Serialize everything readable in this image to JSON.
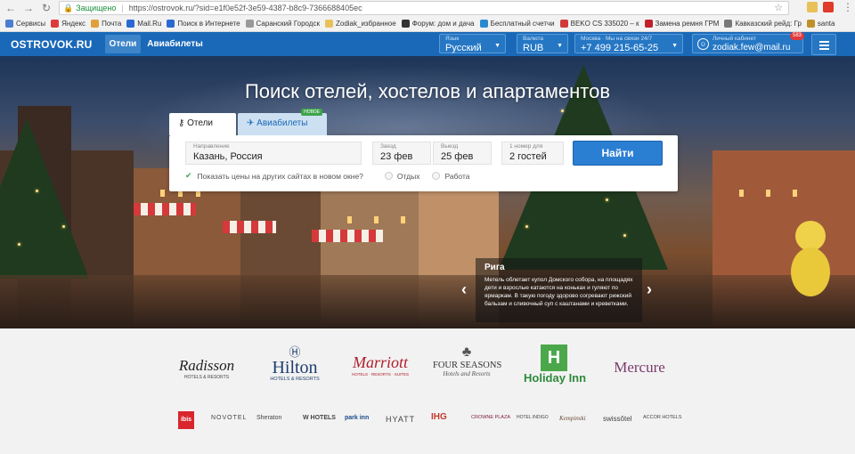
{
  "browser": {
    "secure_label": "Защищено",
    "url": "https://ostrovok.ru/?sid=e1f0e52f-3e59-4387-b8c9-7366688405ec",
    "bookmarks": [
      {
        "label": "Сервисы",
        "icon": "apps-icon",
        "color": "#4a7fd0"
      },
      {
        "label": "Яндекс",
        "icon": "yandex-icon",
        "color": "#e0393a"
      },
      {
        "label": "Почта",
        "icon": "mail-icon",
        "color": "#e0a03a"
      },
      {
        "label": "Mail.Ru",
        "icon": "mailru-icon",
        "color": "#2a6ad0"
      },
      {
        "label": "Поиск в Интернете",
        "icon": "search-icon",
        "color": "#2a6ad0"
      },
      {
        "label": "Саранский Городск",
        "icon": "page-icon",
        "color": "#999999"
      },
      {
        "label": "Zodiak_избранное",
        "icon": "folder-icon",
        "color": "#e8c15a"
      },
      {
        "label": "Форум: дом и дача",
        "icon": "forum-icon",
        "color": "#333333"
      },
      {
        "label": "Бесплатный счетчи",
        "icon": "counter-icon",
        "color": "#2a8ad0"
      },
      {
        "label": "BEKO CS 335020 – к",
        "icon": "beko-icon",
        "color": "#d03a3a"
      },
      {
        "label": "Замена ремня ГРМ",
        "icon": "d-icon",
        "color": "#c0202a"
      },
      {
        "label": "Кавказский рейд: Гр",
        "icon": "settings-icon",
        "color": "#777777"
      },
      {
        "label": "santa",
        "icon": "santa-icon",
        "color": "#c0902a"
      }
    ]
  },
  "topbar": {
    "logo": "OSTROVOK.RU",
    "tabs": [
      "Отели",
      "Авиабилеты"
    ],
    "language_label": "Язык",
    "language_value": "Русский",
    "currency_label": "Валюта",
    "currency_value": "RUB",
    "phone_label": "Москва · Мы на связи 24/7",
    "phone_value": "+7 499 215-65-25",
    "account_label": "Личный кабинет",
    "account_value": "zodiak.few@mail.ru",
    "account_badge": "583"
  },
  "hero": {
    "title": "Поиск отелей, хостелов и апартаментов",
    "tab_hotels": "Отели",
    "tab_flights": "Авиабилеты",
    "new_badge": "НОВОЕ",
    "destination_label": "Направление",
    "destination_value": "Казань, Россия",
    "checkin_label": "Заезд",
    "checkin_value": "23 фев",
    "checkout_label": "Выезд",
    "checkout_value": "25 фев",
    "guests_label": "1 номер для",
    "guests_value": "2 гостей",
    "search_button": "Найти",
    "compare_prices": "Показать цены на других сайтах в новом окне?",
    "option_leisure": "Отдых",
    "option_work": "Работа",
    "city_name": "Рига",
    "city_text": "Метель облетает купол Домского собора, на площадях дети и взрослые катаются на коньках и гуляют по ярмаркам. В такую погоду здорово согревают рижский бальзам и сливочный суп с каштанами и креветками."
  },
  "brands": {
    "radisson": "Radisson",
    "radisson_sub": "HOTELS & RESORTS",
    "hilton": "Hilton",
    "hilton_sub": "HOTELS & RESORTS",
    "marriott": "Marriott",
    "marriott_sub": "HOTELS · RESORTS · SUITES",
    "fourseasons": "FOUR SEASONS",
    "fourseasons_sub": "Hotels and Resorts",
    "holidayinn": "Holiday Inn",
    "mercure": "Mercure",
    "small": [
      "ibis",
      "NOVOTEL",
      "Sheraton",
      "W HOTELS",
      "park inn",
      "HYATT",
      "IHG",
      "CROWNE PLAZA",
      "HOTEL INDIGO",
      "Kempinski",
      "swissôtel",
      "ACCOR HOTELS"
    ]
  }
}
